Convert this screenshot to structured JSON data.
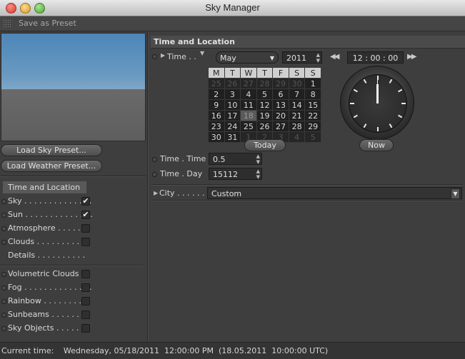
{
  "window": {
    "title": "Sky Manager"
  },
  "toolbar": {
    "save_preset": "Save as Preset"
  },
  "buttons": {
    "load_sky": "Load Sky Preset...",
    "load_weather": "Load Weather Preset...",
    "today": "Today",
    "now": "Now"
  },
  "nav": {
    "section_header": "Time and Location",
    "items": [
      {
        "label": "Sky . . . . . . . . . . . . . .",
        "checked": true
      },
      {
        "label": "Sun . . . . . . . . . . . . . .",
        "checked": true
      },
      {
        "label": "Atmosphere . . . . . .",
        "checked": false
      },
      {
        "label": "Clouds . . . . . . . . . . .",
        "checked": false
      },
      {
        "label": "Details . . . . . . . . . ."
      }
    ],
    "items2": [
      {
        "label": "Volumetric Clouds",
        "checked": false
      },
      {
        "label": "Fog . . . . . . . . . . . . . .",
        "checked": false
      },
      {
        "label": "Rainbow . . . . . . . . .",
        "checked": false
      },
      {
        "label": "Sunbeams . . . . . . .",
        "checked": false
      },
      {
        "label": "Sky Objects . . . . . .",
        "checked": false
      }
    ]
  },
  "panel": {
    "title": "Time and Location",
    "time_label": "Time . .",
    "month": "May",
    "year": "2011",
    "clock_time": "12 : 00 : 00",
    "time_time_label": "Time . Time",
    "time_time_value": "0.5",
    "time_day_label": "Time . Day",
    "time_day_value": "15112",
    "city_label": "City . . . . . . .",
    "city_value": "Custom"
  },
  "calendar": {
    "weekdays": [
      "M",
      "T",
      "W",
      "T",
      "F",
      "S",
      "S"
    ],
    "weeks": [
      [
        {
          "d": "25",
          "o": 1
        },
        {
          "d": "26",
          "o": 1
        },
        {
          "d": "27",
          "o": 1
        },
        {
          "d": "28",
          "o": 1
        },
        {
          "d": "29",
          "o": 1
        },
        {
          "d": "30",
          "o": 1
        },
        {
          "d": "1"
        }
      ],
      [
        {
          "d": "2"
        },
        {
          "d": "3"
        },
        {
          "d": "4"
        },
        {
          "d": "5"
        },
        {
          "d": "6"
        },
        {
          "d": "7"
        },
        {
          "d": "8"
        }
      ],
      [
        {
          "d": "9"
        },
        {
          "d": "10"
        },
        {
          "d": "11"
        },
        {
          "d": "12"
        },
        {
          "d": "13"
        },
        {
          "d": "14"
        },
        {
          "d": "15"
        }
      ],
      [
        {
          "d": "16"
        },
        {
          "d": "17"
        },
        {
          "d": "18",
          "s": 1
        },
        {
          "d": "19"
        },
        {
          "d": "20"
        },
        {
          "d": "21"
        },
        {
          "d": "22"
        }
      ],
      [
        {
          "d": "23"
        },
        {
          "d": "24"
        },
        {
          "d": "25"
        },
        {
          "d": "26"
        },
        {
          "d": "27"
        },
        {
          "d": "28"
        },
        {
          "d": "29"
        }
      ],
      [
        {
          "d": "30"
        },
        {
          "d": "31"
        },
        {
          "d": "1",
          "o": 1
        },
        {
          "d": "2",
          "o": 1
        },
        {
          "d": "3",
          "o": 1
        },
        {
          "d": "4",
          "o": 1
        },
        {
          "d": "5",
          "o": 1
        }
      ]
    ]
  },
  "status": {
    "label": "Current time:",
    "value": "Wednesday, 05/18/2011  12:00:00 PM  (18.05.2011  10:00:00 UTC)"
  },
  "colors": {
    "accent": "#595959",
    "background": "#3e3e3e"
  },
  "icons": {
    "close": "close-icon",
    "minimize": "minimize-icon",
    "zoom": "zoom-icon",
    "grip": "grip-icon",
    "check": "check-icon"
  }
}
